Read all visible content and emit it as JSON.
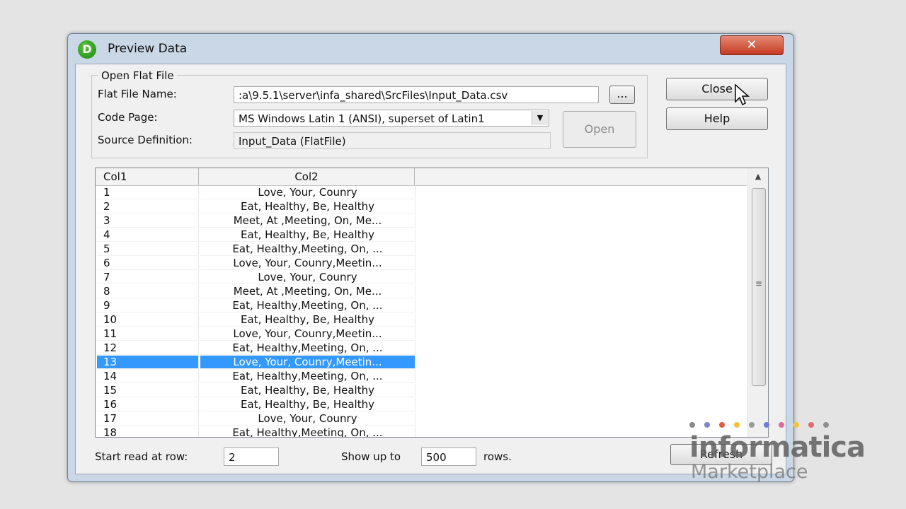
{
  "window": {
    "title": "Preview Data",
    "app_icon_letter": "D",
    "close_glyph": "✕"
  },
  "group": {
    "legend": "Open Flat File",
    "flat_file_name_label": "Flat File Name:",
    "flat_file_name_value": ":a\\9.5.1\\server\\infa_shared\\SrcFiles\\Input_Data.csv",
    "browse_label": "...",
    "code_page_label": "Code Page:",
    "code_page_value": "MS Windows Latin 1 (ANSI), superset of Latin1",
    "source_definition_label": "Source Definition:",
    "source_definition_value": "Input_Data (FlatFile)",
    "open_label": "Open"
  },
  "buttons": {
    "close": "Close",
    "help": "Help",
    "refresh": "Refresh"
  },
  "grid": {
    "columns": [
      "Col1",
      "Col2"
    ],
    "selected_row": "13",
    "rows": [
      [
        "1",
        "Love, Your, Counry"
      ],
      [
        "2",
        "Eat, Healthy, Be, Healthy"
      ],
      [
        "3",
        "Meet, At ,Meeting, On, Me..."
      ],
      [
        "4",
        "Eat, Healthy, Be, Healthy"
      ],
      [
        "5",
        "Eat, Healthy,Meeting, On, ..."
      ],
      [
        "6",
        "Love, Your, Counry,Meetin..."
      ],
      [
        "7",
        "Love, Your, Counry"
      ],
      [
        "8",
        "Meet, At ,Meeting, On, Me..."
      ],
      [
        "9",
        "Eat, Healthy,Meeting, On, ..."
      ],
      [
        "10",
        "Eat, Healthy, Be, Healthy"
      ],
      [
        "11",
        "Love, Your, Counry,Meetin..."
      ],
      [
        "12",
        "Eat, Healthy,Meeting, On, ..."
      ],
      [
        "13",
        "Love, Your, Counry,Meetin..."
      ],
      [
        "14",
        "Eat, Healthy,Meeting, On, ..."
      ],
      [
        "15",
        "Eat, Healthy, Be, Healthy"
      ],
      [
        "16",
        "Eat, Healthy, Be, Healthy"
      ],
      [
        "17",
        "Love, Your, Counry"
      ],
      [
        "18",
        "Eat, Healthy,Meeting, On, ..."
      ]
    ]
  },
  "footer": {
    "start_read_label": "Start read at row:",
    "start_read_value": "2",
    "show_up_to_label": "Show up to",
    "show_up_to_value": "500",
    "rows_label": "rows."
  },
  "watermark": {
    "brand": "informatica",
    "sub": "Marketplace",
    "dot_colors": [
      "#8a8a8a",
      "#7a86c9",
      "#e05a4a",
      "#f3c23a",
      "#9a9a9a",
      "#6c7bd6",
      "#e26a9a",
      "#f0c63c",
      "#e36b6b",
      "#8e8e8e"
    ]
  },
  "icons": {
    "dropdown": "chevron-down-icon",
    "scroll_up": "arrow-up-icon",
    "scroll_grip": "grip-icon",
    "cursor": "mouse-pointer-icon"
  }
}
